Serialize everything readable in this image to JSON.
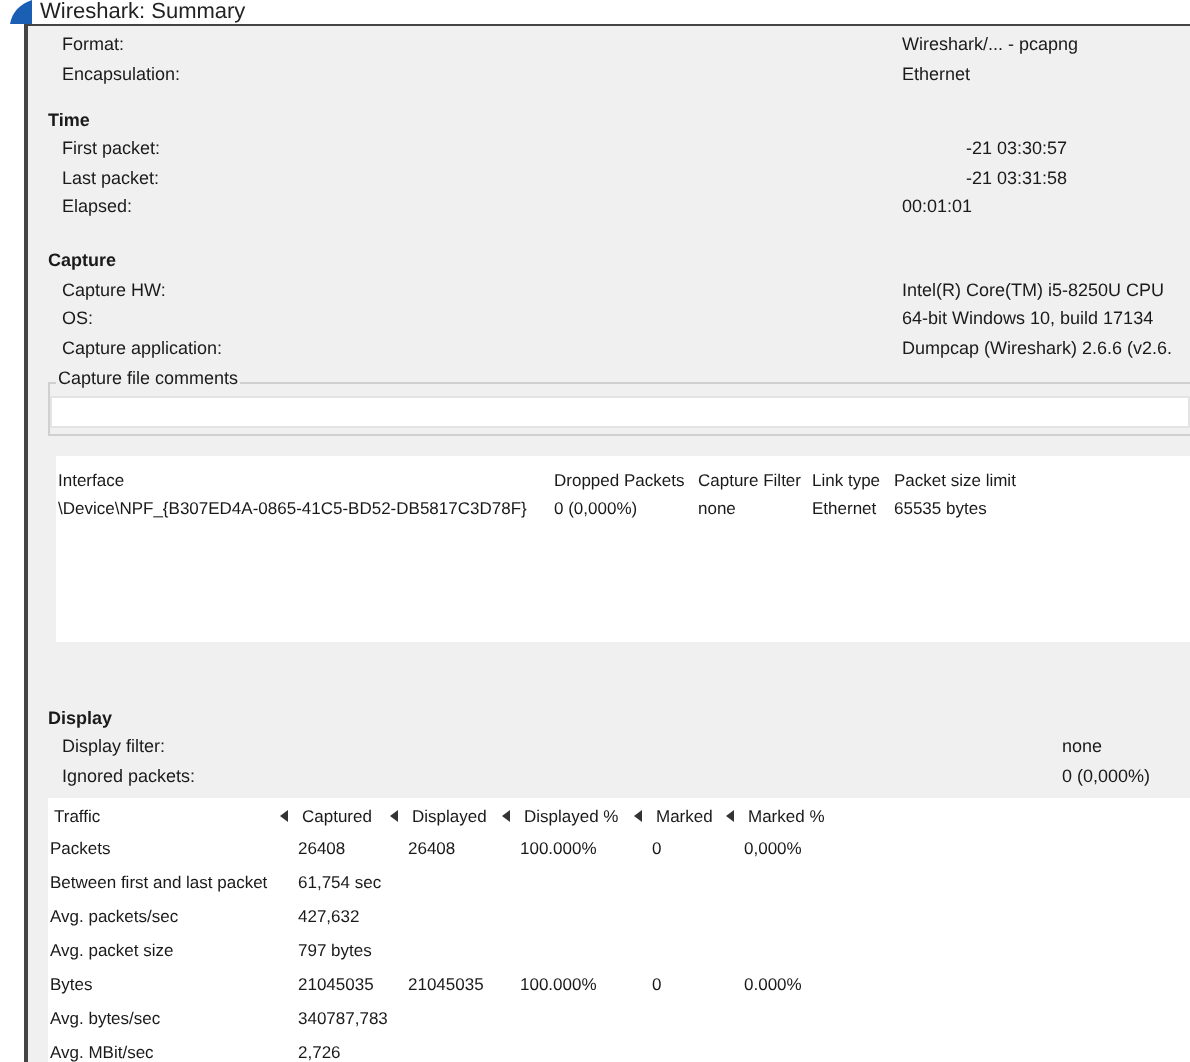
{
  "window": {
    "title": "Wireshark: Summary"
  },
  "file_rows": [
    {
      "label": "Format:",
      "value": "Wireshark/... - pcapng"
    },
    {
      "label": "Encapsulation:",
      "value": "Ethernet"
    }
  ],
  "sections": [
    {
      "title": "Time",
      "rows": [
        {
          "label": "First packet:",
          "value": "-21 03:30:57",
          "indent": true
        },
        {
          "label": "Last packet:",
          "value": "-21 03:31:58",
          "indent": true
        },
        {
          "label": "Elapsed:",
          "value": "00:01:01",
          "indent": false
        }
      ]
    },
    {
      "title": "Capture",
      "rows": [
        {
          "label": "Capture HW:",
          "value": "Intel(R) Core(TM) i5-8250U CPU",
          "indent": false
        },
        {
          "label": "OS:",
          "value": "64-bit Windows 10, build 17134",
          "indent": false
        },
        {
          "label": "Capture application:",
          "value": "Dumpcap (Wireshark) 2.6.6 (v2.6.",
          "indent": false
        }
      ]
    }
  ],
  "comments": {
    "legend": "Capture file comments"
  },
  "interfaces": {
    "columns": [
      "Interface",
      "Dropped Packets",
      "Capture Filter",
      "Link type",
      "Packet size limit"
    ],
    "rows": [
      [
        "\\Device\\NPF_{B307ED4A-0865-41C5-BD52-DB5817C3D78F}",
        "0 (0,000%)",
        "none",
        "Ethernet",
        "65535 bytes"
      ]
    ]
  },
  "display": {
    "title": "Display",
    "rows": [
      {
        "label": "Display filter:",
        "value": "none"
      },
      {
        "label": "Ignored packets:",
        "value": "0 (0,000%)"
      }
    ]
  },
  "traffic": {
    "columns": [
      "Traffic",
      "Captured",
      "Displayed",
      "Displayed %",
      "Marked",
      "Marked %"
    ],
    "rows": [
      [
        "Packets",
        "26408",
        "26408",
        "100.000%",
        "0",
        "0,000%"
      ],
      [
        "Between first and last packet",
        "61,754 sec"
      ],
      [
        "Avg. packets/sec",
        "427,632"
      ],
      [
        "Avg. packet size",
        "797 bytes"
      ],
      [
        "Bytes",
        "21045035",
        "21045035",
        "100.000%",
        "0",
        "0.000%"
      ],
      [
        "Avg. bytes/sec",
        "340787,783"
      ],
      [
        "Avg. MBit/sec",
        "2,726"
      ]
    ]
  }
}
